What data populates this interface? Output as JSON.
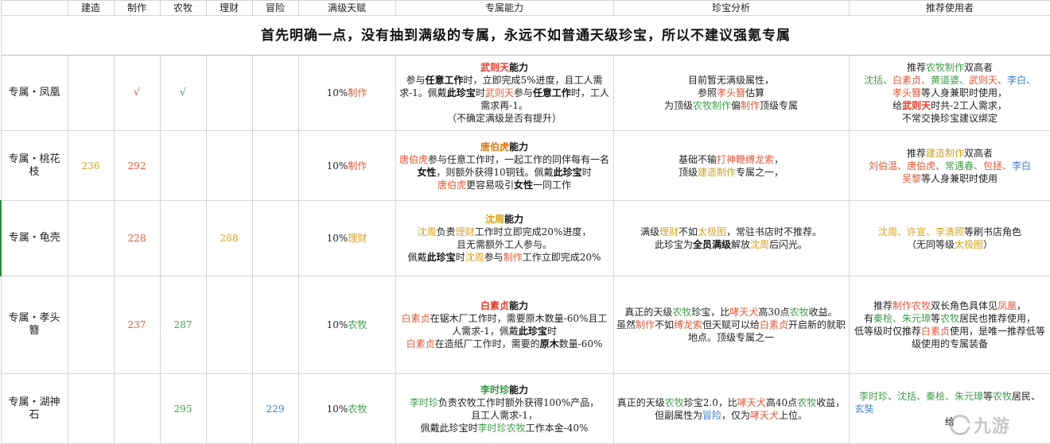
{
  "header": {
    "blank": "",
    "build": "建造",
    "make": "制作",
    "farm": "农牧",
    "money": "理财",
    "adventure": "冒险",
    "talent": "满级天赋",
    "ability": "专属能力",
    "analysis": "珍宝分析",
    "recommend": "推荐使用者"
  },
  "banner": "首先明确一点，没有抽到满级的专属，永远不如普通天级珍宝，所以不建议强氪专属",
  "rows": [
    {
      "name": "专属・凤凰",
      "build": "",
      "make": "√",
      "farm": "√",
      "money": "",
      "adventure": "",
      "talent_pct": "10%",
      "talent_type": "制作",
      "ability": {
        "who": "武则天",
        "suffix": "能力",
        "l1a": "参与",
        "l1b": "任意工作",
        "l1c": "时，立即完成5%进度，且工人需求-1。佩戴",
        "l1d": "此珍宝",
        "l1e": "时",
        "l1f": "武则天",
        "l1g": "参与",
        "l1h": "任意工作",
        "l1i": "时，工人需求再-1。",
        "l2": "（不确定满级是否有提升）"
      },
      "analysis": {
        "l1": "目前暂无满级属性，",
        "l2a": "参照",
        "l2b": "孝头簪",
        "l2c": "估算",
        "l3a": "为顶级",
        "l3b": "农牧制作",
        "l3c": "偏",
        "l3d": "制作",
        "l3e": "顶级专属"
      },
      "rec": {
        "l1a": "推荐",
        "l1b": "农牧制作",
        "l1c": "双高者",
        "n1": "沈括、",
        "n2": "白素贞、",
        "n3": "黄道婆、",
        "n4": "武则天、",
        "n5": "李白、",
        "l3a": "",
        "l3b": "孝头簪",
        "l3c": "等人身兼职时使用，",
        "l4a": "给",
        "l4b": "武则天",
        "l4c": "时共-2工人需求，",
        "l5": "不常交换珍宝建议绑定"
      }
    },
    {
      "name": "专属・桃花枝",
      "build": "236",
      "make": "292",
      "farm": "",
      "money": "",
      "adventure": "",
      "talent_pct": "10%",
      "talent_type": "制作",
      "ability": {
        "who": "唐伯虎",
        "suffix": "能力",
        "l1a": "唐伯虎",
        "l1b": "参与任意工作时，一起工作的同伴每有一名",
        "l1c": "女性",
        "l1d": "，则额外获得10铜钱。佩戴",
        "l1e": "此珍宝",
        "l1f": "时",
        "l2a": "唐伯虎",
        "l2b": "更容易吸引",
        "l2c": "女性",
        "l2d": "一同工作"
      },
      "analysis": {
        "l1a": "基础不输",
        "l1b": "打神鞭缚龙索",
        "l1c": "，",
        "l2a": "顶级",
        "l2b": "建造制作",
        "l2c": "专属之一，"
      },
      "rec": {
        "l1a": "推荐",
        "l1b": "建造制作",
        "l1c": "双高者",
        "n1": "刘伯温、",
        "n2": "唐伯虎、",
        "n3": "常遇春、",
        "n4": "包拯、",
        "n5": "李白",
        "n6": "吴黎",
        "l3": "等人身兼职时使用"
      }
    },
    {
      "name": "专属・龟壳",
      "build": "",
      "make": "228",
      "farm": "",
      "money": "288",
      "adventure": "",
      "talent_pct": "10%",
      "talent_type": "理财",
      "ability": {
        "who": "沈周",
        "suffix": "能力",
        "l1a": "沈周",
        "l1b": "负责",
        "l1c": "理财",
        "l1d": "工作时立即完成20%进度，",
        "l2": "且无需额外工人参与。",
        "l3a": "佩戴",
        "l3b": "此珍宝",
        "l3c": "时",
        "l3d": "沈周",
        "l3e": "参与",
        "l3f": "制作",
        "l3g": "工作立即完成20%"
      },
      "analysis": {
        "l1a": "满级",
        "l1b": "理财",
        "l1c": "不如",
        "l1d": "太极图",
        "l1e": "，常驻书店时不推荐。",
        "l2a": "此珍宝为",
        "l2b": "全员满级",
        "l2c": "解放",
        "l2d": "沈周",
        "l2e": "后闪光。"
      },
      "rec": {
        "n1": "沈周、",
        "n2": "许宣、",
        "n3": "李清照",
        "l1b": "等刷书店角色",
        "l2a": "（无同等级",
        "l2b": "太极图",
        "l2c": "）"
      }
    },
    {
      "name": "专属・孝头簪",
      "build": "",
      "make": "237",
      "farm": "287",
      "money": "",
      "adventure": "",
      "talent_pct": "10%",
      "talent_type": "农牧",
      "ability": {
        "who": "白素贞",
        "suffix": "能力",
        "l1a": "白素贞",
        "l1b": "在锯木厂工作时，需要原木数量-60%且工人需求-1，佩戴",
        "l1c": "此珍宝",
        "l1d": "时",
        "l2a": "白素贞",
        "l2b": "在造纸厂工作时，需要的",
        "l2c": "原木",
        "l2d": "数量-60%"
      },
      "analysis": {
        "l1a": "真正的天级",
        "l1b": "农牧",
        "l1c": "珍宝，比",
        "l1d": "哮天犬",
        "l1e": "高30点",
        "l1f": "农牧",
        "l1g": "收益。",
        "l2a": "虽然",
        "l2b": "制作",
        "l2c": "不如",
        "l2d": "缚龙索",
        "l2e": "但天赋可以给",
        "l2f": "白素贞",
        "l2g": "开启新的就职地点。顶级专属之一"
      },
      "rec": {
        "l1a": "推荐",
        "l1b": "制作农牧",
        "l1c": "双长角色具体见",
        "l1d": "凤凰",
        "l1e": "，",
        "l2a": "有",
        "l2b": "秦桧、朱元璋",
        "l2c": "等",
        "l2d": "农牧",
        "l2e": "居民也推荐使用，",
        "l3a": "低等级时仅推荐",
        "l3b": "白素贞",
        "l3c": "使用，是唯一推荐低等级使用的专属装备"
      }
    },
    {
      "name": "专属・湖神石",
      "build": "",
      "make": "",
      "farm": "295",
      "money": "",
      "adventure": "229",
      "talent_pct": "10%",
      "talent_type": "农牧",
      "ability": {
        "who": "李时珍",
        "suffix": "能力",
        "l1a": "李时珍",
        "l1b": "负责农牧工作时额外获得100%产品，",
        "l2": "且工人需求-1，",
        "l3a": "佩戴此珍宝时",
        "l3b": "李时珍",
        "l3c": "农牧",
        "l3d": "工作本金-40%"
      },
      "analysis": {
        "l1a": "真正的天级",
        "l1b": "农牧",
        "l1c": "珍宝2.0，比",
        "l1d": "哮天犬",
        "l1e": "高40点",
        "l1f": "农牧",
        "l1g": "收益，",
        "l2a": "但副属性为",
        "l2b": "冒险",
        "l2c": "，仅为",
        "l2d": "哮天犬",
        "l2e": "上位。"
      },
      "rec": {
        "l1a": "李时珍、沈括、秦桧、朱元璋",
        "l1b": "等",
        "l1c": "农牧",
        "l1d": "居民、",
        "l2a": "玄奘",
        "l3a": "给"
      }
    }
  ],
  "watermark": "九游"
}
